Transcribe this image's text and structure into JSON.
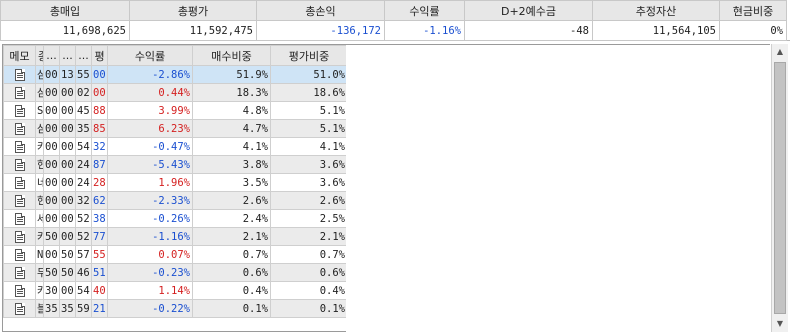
{
  "summary": {
    "headers": [
      "총매입",
      "총평가",
      "총손익",
      "수익률",
      "D+2예수금",
      "추정자산",
      "현금비중"
    ],
    "values": [
      "11,698,625",
      "11,592,475",
      "-136,172",
      "-1.16%",
      "-48",
      "11,564,105",
      "0%"
    ]
  },
  "grid": {
    "headers": [
      "메모",
      "종",
      "...",
      "...",
      "...",
      "평",
      "수익률",
      "매수비중",
      "평가비중"
    ],
    "rows": [
      {
        "c1": "삼",
        "c2": "00",
        "c3": "13",
        "c4": "55",
        "c5": "00",
        "rate": "-2.86%",
        "buy": "51.9%",
        "eval": "51.0%"
      },
      {
        "c1": "삼",
        "c2": "00",
        "c3": "00",
        "c4": "02",
        "c5": "00",
        "rate": "0.44%",
        "buy": "18.3%",
        "eval": "18.6%"
      },
      {
        "c1": "S",
        "c2": "00",
        "c3": "00",
        "c4": "45",
        "c5": "88",
        "rate": "3.99%",
        "buy": "4.8%",
        "eval": "5.1%"
      },
      {
        "c1": "삼",
        "c2": "00",
        "c3": "00",
        "c4": "35",
        "c5": "85",
        "rate": "6.23%",
        "buy": "4.7%",
        "eval": "5.1%"
      },
      {
        "c1": "카",
        "c2": "00",
        "c3": "00",
        "c4": "54",
        "c5": "32",
        "rate": "-0.47%",
        "buy": "4.1%",
        "eval": "4.1%"
      },
      {
        "c1": "현",
        "c2": "00",
        "c3": "00",
        "c4": "24",
        "c5": "87",
        "rate": "-5.43%",
        "buy": "3.8%",
        "eval": "3.6%"
      },
      {
        "c1": "네",
        "c2": "00",
        "c3": "00",
        "c4": "24",
        "c5": "28",
        "rate": "1.96%",
        "buy": "3.5%",
        "eval": "3.6%"
      },
      {
        "c1": "현",
        "c2": "00",
        "c3": "00",
        "c4": "32",
        "c5": "62",
        "rate": "-2.33%",
        "buy": "2.6%",
        "eval": "2.6%"
      },
      {
        "c1": "세",
        "c2": "00",
        "c3": "00",
        "c4": "52",
        "c5": "38",
        "rate": "-0.26%",
        "buy": "2.4%",
        "eval": "2.5%"
      },
      {
        "c1": "카",
        "c2": "50",
        "c3": "00",
        "c4": "52",
        "c5": "77",
        "rate": "-1.16%",
        "buy": "2.1%",
        "eval": "2.1%"
      },
      {
        "c1": "N",
        "c2": "00",
        "c3": "50",
        "c4": "57",
        "c5": "55",
        "rate": "0.07%",
        "buy": "0.7%",
        "eval": "0.7%"
      },
      {
        "c1": "무",
        "c2": "50",
        "c3": "50",
        "c4": "46",
        "c5": "51",
        "rate": "-0.23%",
        "buy": "0.6%",
        "eval": "0.6%"
      },
      {
        "c1": "카",
        "c2": "30",
        "c3": "00",
        "c4": "54",
        "c5": "40",
        "rate": "1.14%",
        "buy": "0.4%",
        "eval": "0.4%"
      },
      {
        "c1": "블",
        "c2": "35",
        "c3": "35",
        "c4": "59",
        "c5": "21",
        "rate": "-0.22%",
        "buy": "0.1%",
        "eval": "0.1%"
      }
    ]
  },
  "colors": {
    "negative": "#1a4fd0",
    "positive": "#d41f1f",
    "header_bg": "#e7e7e7",
    "selected_row": "#cfe4f6",
    "alt_row": "#ebebeb"
  },
  "icons": {
    "memo": "memo-icon",
    "scroll_up": "scroll-up-arrow-icon",
    "scroll_down": "scroll-down-arrow-icon"
  }
}
